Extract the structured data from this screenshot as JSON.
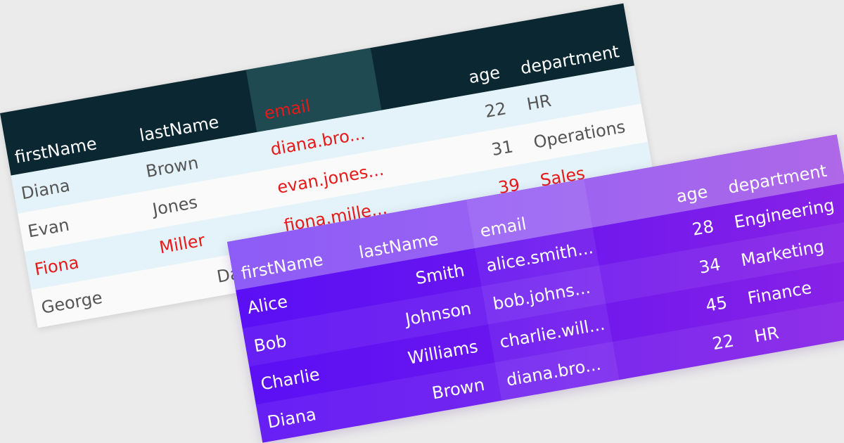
{
  "grid_light": {
    "columns": [
      {
        "label": "firstName"
      },
      {
        "label": "lastName"
      },
      {
        "label": "email"
      },
      {
        "label": "age"
      },
      {
        "label": "department"
      }
    ],
    "rows": [
      {
        "firstName": "Diana",
        "lastName": "Brown",
        "email": "diana.bro...",
        "age": "22",
        "department": "HR"
      },
      {
        "firstName": "Evan",
        "lastName": "Jones",
        "email": "evan.jones...",
        "age": "31",
        "department": "Operations"
      },
      {
        "firstName": "Fiona",
        "lastName": "Miller",
        "email": "fiona.mille...",
        "age": "39",
        "department": "Sales"
      },
      {
        "firstName": "George",
        "lastName": "Davis",
        "email": "",
        "age": "",
        "department": ""
      }
    ]
  },
  "grid_purple": {
    "columns": [
      {
        "label": "firstName"
      },
      {
        "label": "lastName"
      },
      {
        "label": "email"
      },
      {
        "label": "age"
      },
      {
        "label": "department"
      }
    ],
    "rows": [
      {
        "firstName": "Alice",
        "lastName": "Smith",
        "email": "alice.smith...",
        "age": "28",
        "department": "Engineering"
      },
      {
        "firstName": "Bob",
        "lastName": "Johnson",
        "email": "bob.johns...",
        "age": "34",
        "department": "Marketing"
      },
      {
        "firstName": "Charlie",
        "lastName": "Williams",
        "email": "charlie.will...",
        "age": "45",
        "department": "Finance"
      },
      {
        "firstName": "Diana",
        "lastName": "Brown",
        "email": "diana.bro...",
        "age": "22",
        "department": "HR"
      }
    ]
  },
  "colors": {
    "light_header_bg": "#0b2731",
    "light_sorted_header_bg": "#1f4a52",
    "light_alt_row_bg": "#e4f3f9",
    "highlight_text": "#e81919",
    "purple_header_start": "#8d5cf7",
    "purple_body_start": "#5a0ff5",
    "purple_body_end": "#8a22e6"
  }
}
